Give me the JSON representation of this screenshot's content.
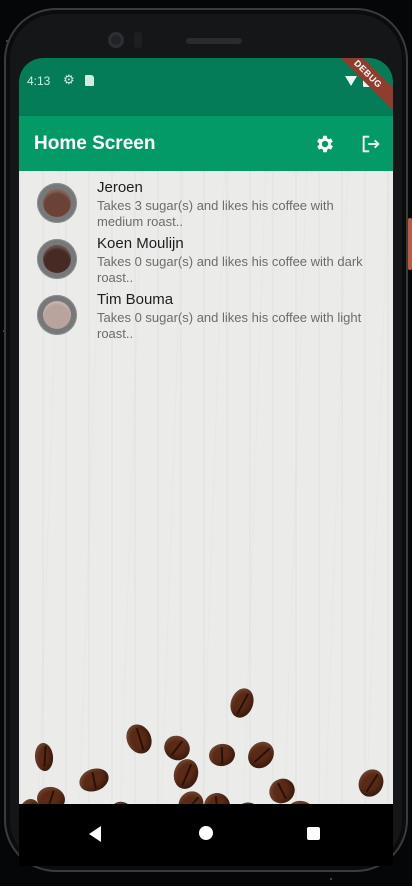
{
  "status_bar": {
    "time": "4:13",
    "debug_label": "DEBUG"
  },
  "app_bar": {
    "title": "Home Screen"
  },
  "icons": {
    "settings": "gear-icon",
    "logout": "logout-icon"
  },
  "people": [
    {
      "name": "Jeroen",
      "description": "Takes 3 sugar(s) and likes his coffee with medium roast..",
      "roast_color": "#6b4336"
    },
    {
      "name": "Koen Moulijn",
      "description": "Takes 0 sugar(s) and likes his coffee with dark roast..",
      "roast_color": "#472a24"
    },
    {
      "name": "Tim Bouma",
      "description": "Takes 0 sugar(s) and likes his coffee with light roast..",
      "roast_color": "#b9a39c"
    }
  ],
  "colors": {
    "app_bar": "#049a67",
    "status_bar": "#047c57"
  }
}
